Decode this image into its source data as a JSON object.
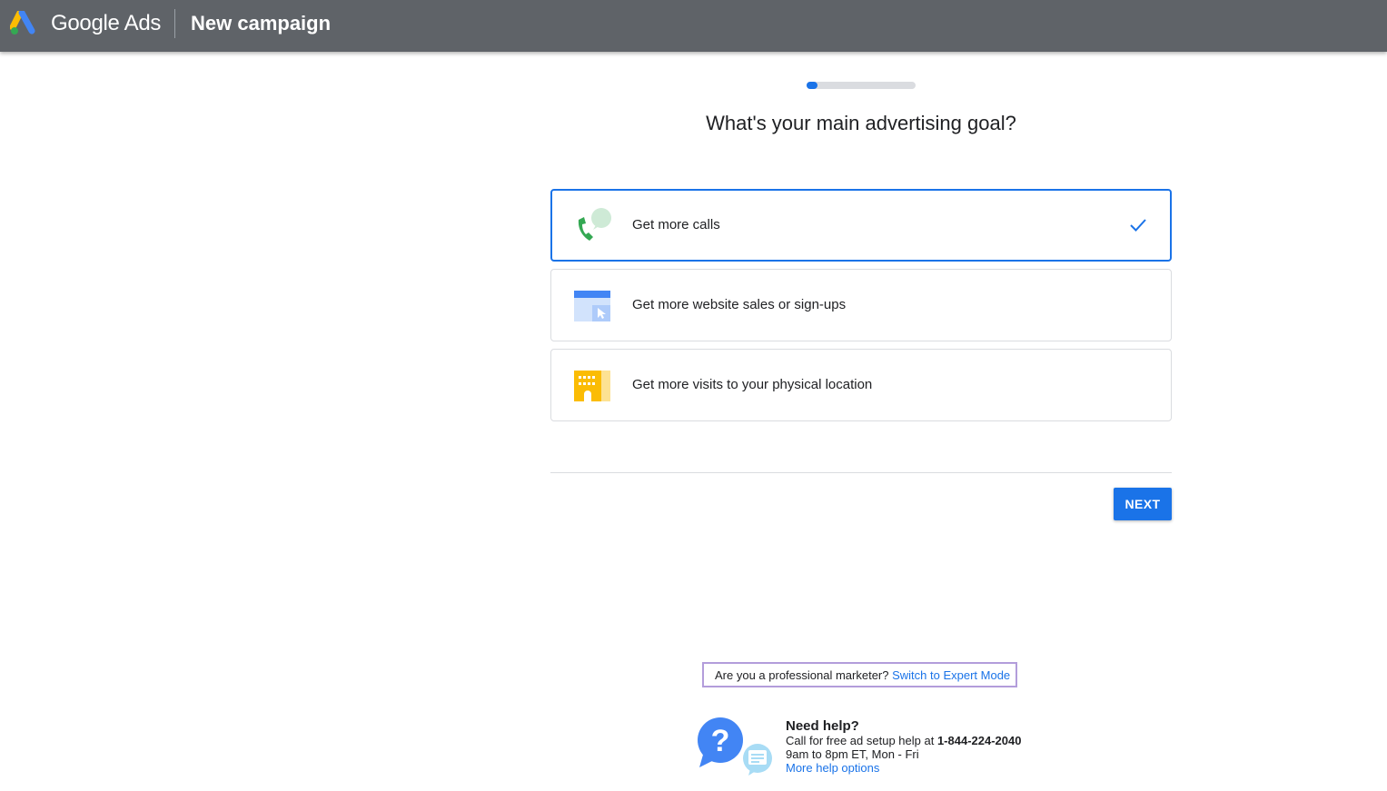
{
  "header": {
    "brand": "Google Ads",
    "title": "New campaign"
  },
  "progress": {
    "step": 1,
    "fraction": 0.07
  },
  "question": "What's your main advertising goal?",
  "options": [
    {
      "label": "Get more calls",
      "icon": "phone-chat-icon",
      "selected": true
    },
    {
      "label": "Get more website sales or sign-ups",
      "icon": "website-cursor-icon",
      "selected": false
    },
    {
      "label": "Get more visits to your physical location",
      "icon": "storefront-icon",
      "selected": false
    }
  ],
  "next_button": "NEXT",
  "expert": {
    "prompt": "Are you a professional marketer?",
    "link": "Switch to Expert Mode"
  },
  "help": {
    "title": "Need help?",
    "line1_prefix": "Call for free ad setup help at",
    "phone": "1-844-224-2040",
    "hours": "9am to 8pm ET, Mon - Fri",
    "link": "More help options"
  },
  "colors": {
    "accent": "#1a73e8",
    "header_bg": "#5f6368",
    "highlight_border": "#b39ddb"
  }
}
